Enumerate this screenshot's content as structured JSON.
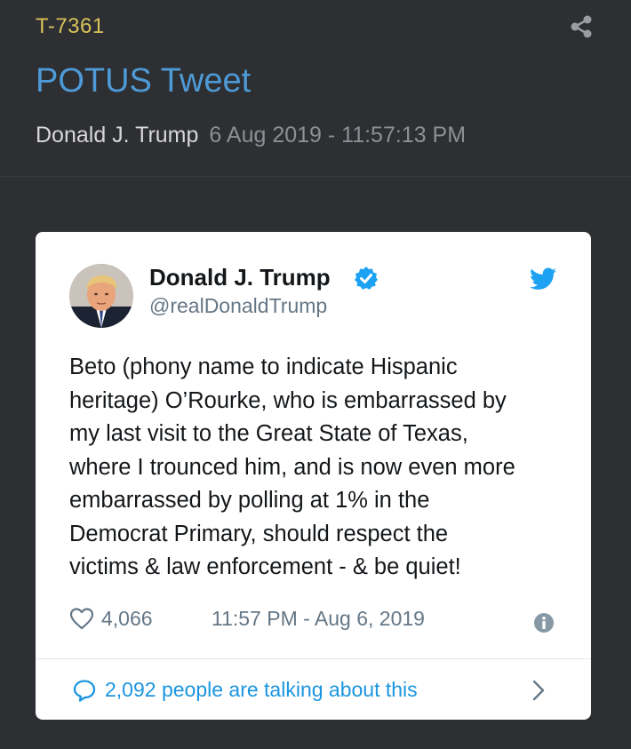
{
  "header": {
    "drop_id": "T-7361",
    "title": "POTUS Tweet",
    "author": "Donald J. Trump",
    "date": "6 Aug 2019 - 11:57:13 PM"
  },
  "tweet": {
    "author_name": "Donald J. Trump",
    "handle": "@realDonaldTrump",
    "text": "Beto (phony name to indicate Hispanic\nheritage) O’Rourke, who is embarrassed by\nmy last visit to the Great State of Texas,\nwhere I trounced him, and is now even more\nembarrassed by polling at 1% in the\nDemocrat Primary, should respect the\nvictims & law enforcement - & be quiet!",
    "likes": "4,066",
    "time": "11:57 PM - Aug 6, 2019",
    "talking": "2,092 people are talking about this"
  },
  "icons": {
    "share": "share-icon",
    "verified": "verified-badge-icon",
    "bird": "twitter-bird-icon",
    "heart": "heart-icon",
    "info": "info-icon",
    "bubble": "comment-bubble-icon",
    "chevron": "chevron-right-icon"
  },
  "colors": {
    "background": "#2d2f33",
    "drop_id": "#d8c25a",
    "title": "#4e9ad6",
    "twitter_blue": "#1da1f2",
    "link_blue": "#1b95e0"
  }
}
